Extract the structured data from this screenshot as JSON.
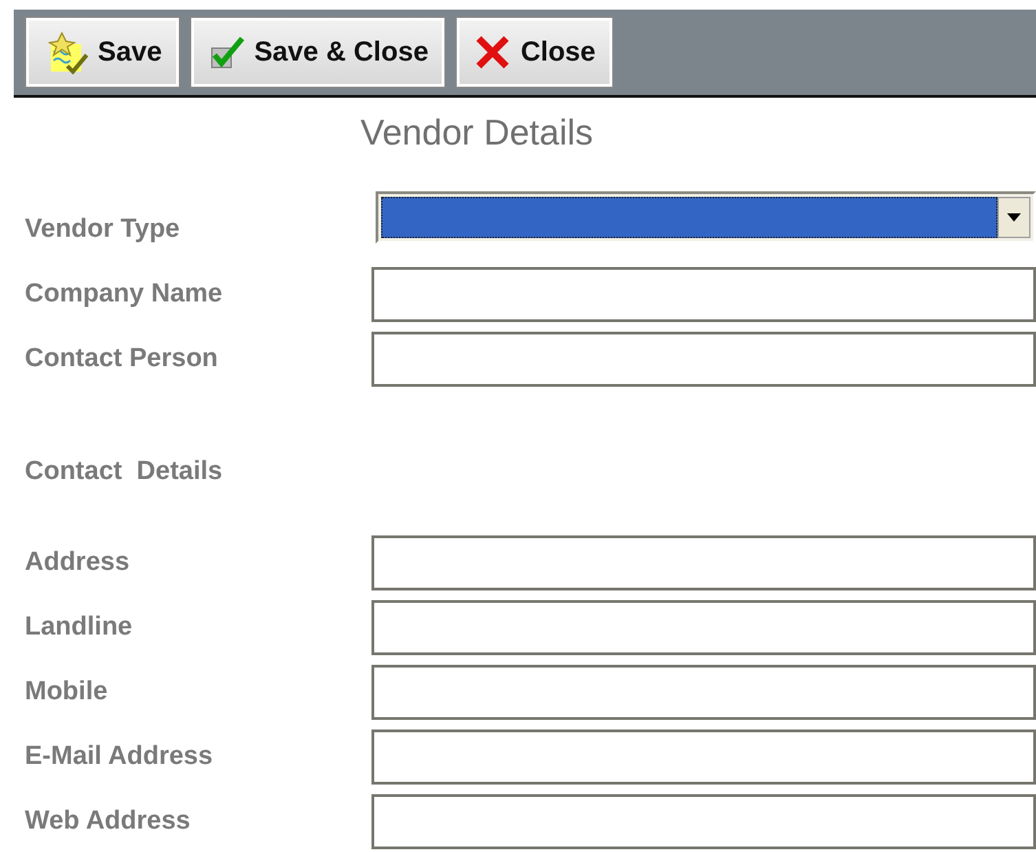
{
  "toolbar": [
    {
      "label": "Save",
      "kind": "save"
    },
    {
      "label": "Save & Close",
      "kind": "check"
    },
    {
      "label": "Close",
      "kind": "close"
    }
  ],
  "title": "Vendor Details",
  "rows": [
    {
      "kind": "dropdown",
      "label": "Vendor Type",
      "focused": true
    },
    {
      "kind": "text",
      "label": "Company Name"
    },
    {
      "kind": "text",
      "label": "Contact Person"
    },
    {
      "kind": "heading",
      "label": "Contact  Details"
    },
    {
      "kind": "text",
      "label": "Address"
    },
    {
      "kind": "text",
      "label": "Landline"
    },
    {
      "kind": "text",
      "label": "Mobile"
    },
    {
      "kind": "text",
      "label": "E-Mail Address"
    },
    {
      "kind": "text",
      "label": "Web Address"
    }
  ]
}
